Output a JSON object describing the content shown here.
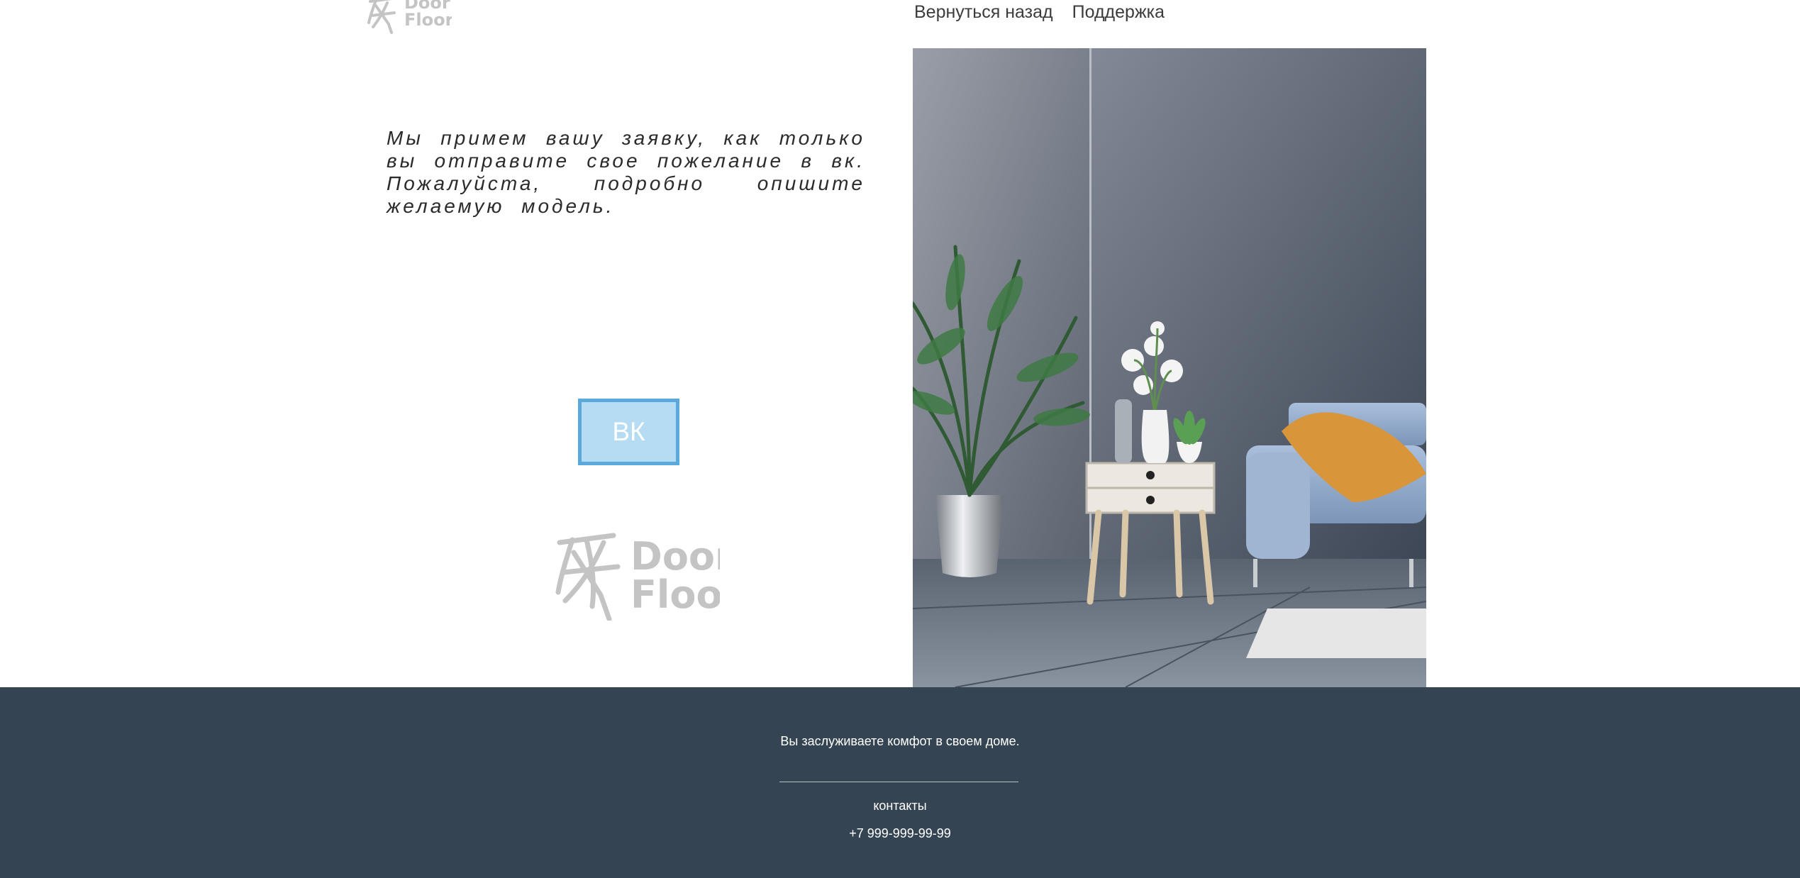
{
  "brand": {
    "logo_line1": "Door",
    "logo_line2": "Floor"
  },
  "nav": {
    "back_label": "Вернуться назад",
    "support_label": "Поддержка"
  },
  "main": {
    "message": "Мы примем вашу заявку, как только вы отправите свое пожелание в вк. Пожалуйста, подробно опишите желаемую модель.",
    "vk_button_label": "ВК"
  },
  "footer": {
    "tagline": "Вы заслуживаете комфот в своем доме.",
    "contacts_label": "контакты",
    "phone": "+7 999-999-99-99"
  },
  "colors": {
    "footer_bg": "#344452",
    "vk_border": "#5aa8dc",
    "vk_fill": "#b5dcf3",
    "logo_gray": "#c4c4c4"
  },
  "icons": {
    "logo_mark": "door-floor-logo-icon"
  }
}
